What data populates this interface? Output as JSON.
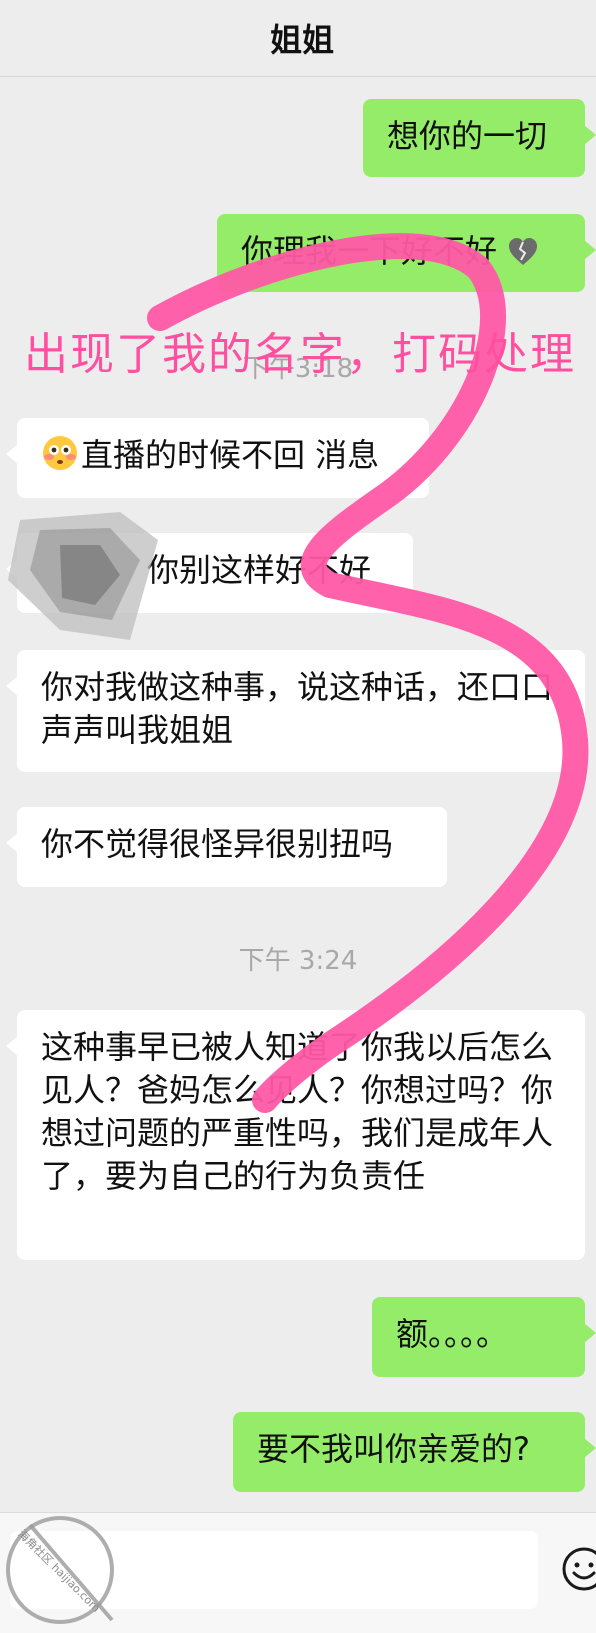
{
  "header": {
    "title": "姐姐"
  },
  "messages": {
    "m1": "想你的一切",
    "m2": "你理我一下好不好",
    "m4": "直播的时候不回 消息",
    "m5": "你别这样好不好",
    "m6": "你对我做这种事，说这种话，还口口声声叫我姐姐",
    "m7": "你不觉得很怪异很别扭吗",
    "m8": "这种事早已被人知道了你我以后怎么见人？爸妈怎么见人？你想过吗？你想过问题的严重性吗，我们是成年人了，要为自己的行为负责任",
    "m9": "额。。。。",
    "m10": "要不我叫你亲爱的?"
  },
  "timestamps": {
    "t1": "下午3:18",
    "t2": "下午 3:24"
  },
  "overlay": {
    "annotation": "出现了我的名字，打码处理"
  },
  "watermark": {
    "text": "海角社区 haijiao.com"
  },
  "icons": {
    "broken_heart": "broken-heart-emoji",
    "flushed_face": "flushed-face-emoji",
    "emoji_button": "smiley-icon"
  },
  "colors": {
    "my_bubble": "#95ec69",
    "their_bubble": "#ffffff",
    "scribble": "#ff5aa5",
    "background": "#ededed"
  }
}
